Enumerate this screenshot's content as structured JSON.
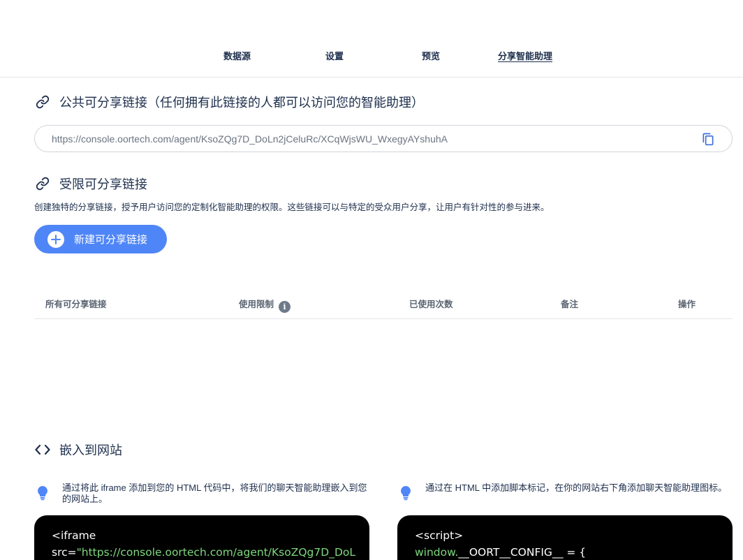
{
  "nav": {
    "tabs": [
      {
        "label": "数据源"
      },
      {
        "label": "设置"
      },
      {
        "label": "预览"
      },
      {
        "label": "分享智能助理",
        "active": true
      }
    ]
  },
  "public_link": {
    "title": "公共可分享链接（任何拥有此链接的人都可以访问您的智能助理）",
    "url": "https://console.oortech.com/agent/KsoZQg7D_DoLn2jCeluRc/XCqWjsWU_WxegyAYshuhA",
    "copy_icon": "copy-icon"
  },
  "restricted_link": {
    "title": "受限可分享链接",
    "description": "创建独特的分享链接，授予用户访问您的定制化智能助理的权限。这些链接可以与特定的受众用户分享，让用户有针对性的参与进来。",
    "new_button_label": "新建可分享链接",
    "table": {
      "headers": [
        "所有可分享链接",
        "使用限制",
        "已使用次数",
        "备注",
        "操作"
      ],
      "info_icon": "i",
      "rows": []
    }
  },
  "embed": {
    "title": "嵌入到网站",
    "iframe_tip": "通过将此 iframe 添加到您的 HTML 代码中，将我们的聊天智能助理嵌入到您的网站上。",
    "script_tip": "通过在 HTML 中添加脚本标记，在你的网站右下角添加聊天智能助理图标。",
    "iframe_code": {
      "line1": "<iframe",
      "attr": "src=",
      "value": "\"https://console.oortech.com/agent/KsoZQg7D_DoL"
    },
    "script_code": {
      "line1": "<script>",
      "obj": "window.",
      "rest": "__OORT__CONFIG__ = {"
    }
  },
  "colors": {
    "accent": "#4f86f7",
    "text": "#1e2f4d",
    "code_bg": "#000000",
    "code_string": "#7dd87d"
  }
}
